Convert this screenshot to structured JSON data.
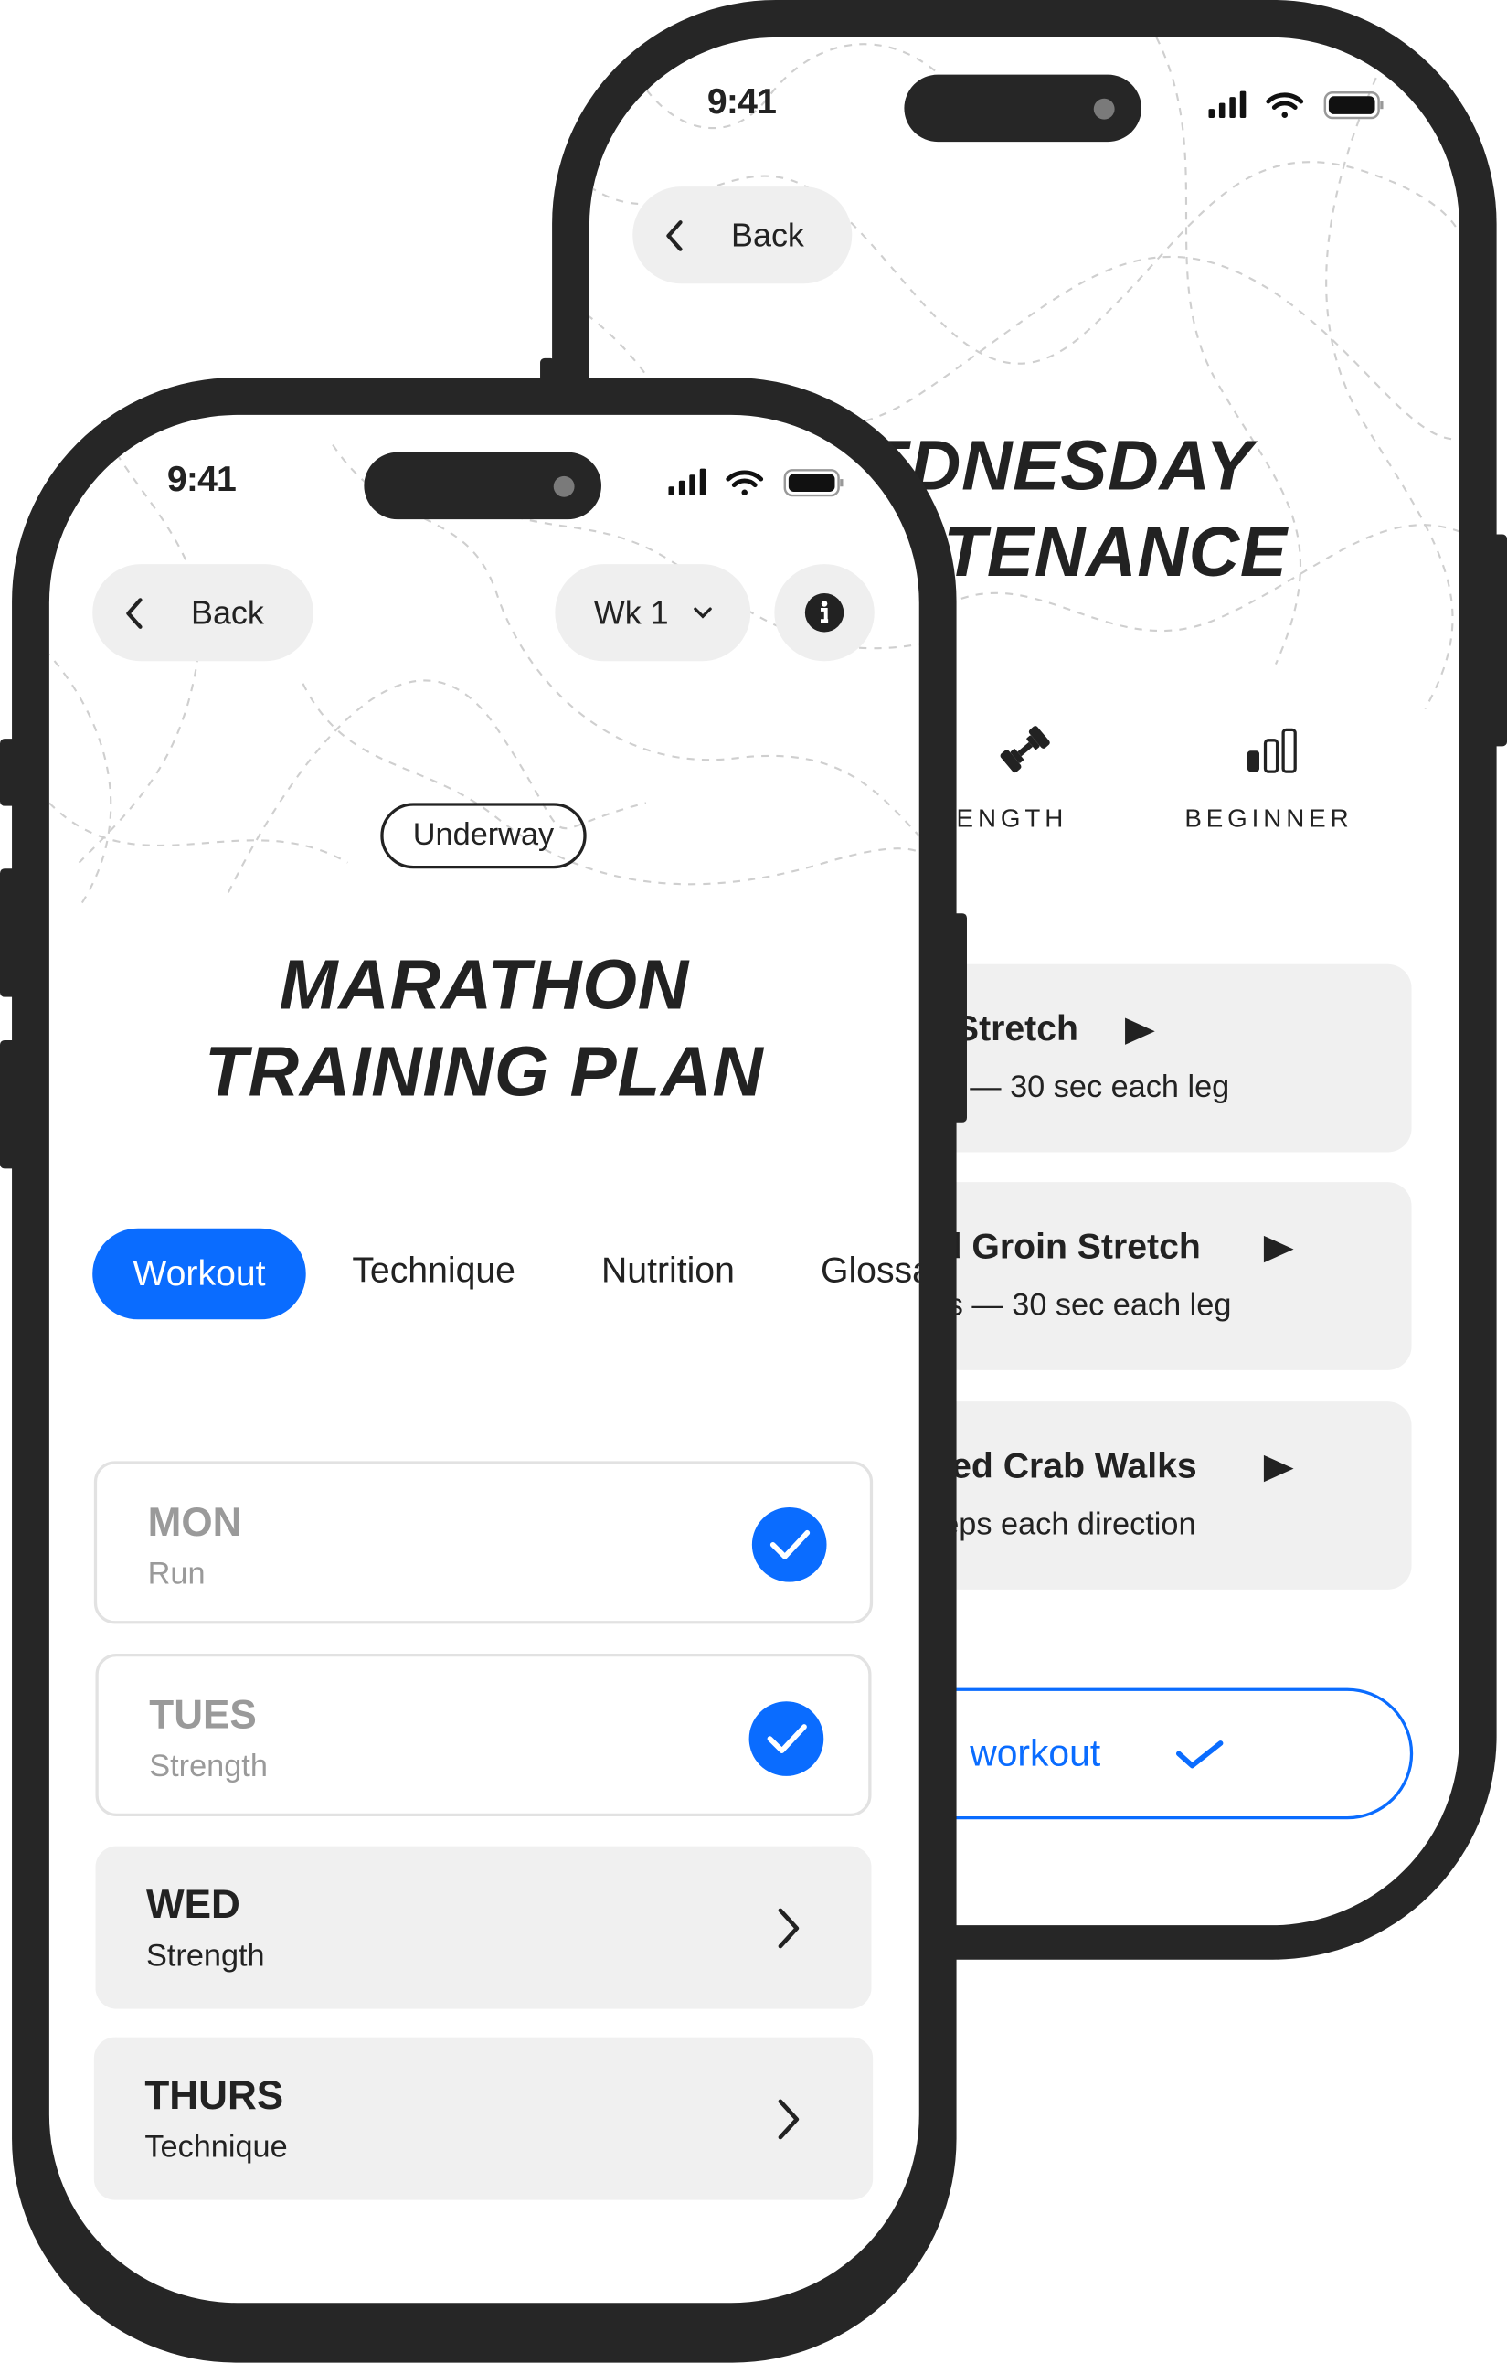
{
  "back_phone": {
    "status": {
      "time": "9:41"
    },
    "back_label": "Back",
    "title_line1": "WEDNESDAY",
    "title_line2": "MAINTENANCE",
    "tags": [
      {
        "icon": "dumbbell-icon",
        "label": "STRENGTH"
      },
      {
        "icon": "level-bars-icon",
        "label": "BEGINNER"
      }
    ],
    "exercises": [
      {
        "title": "Stretch",
        "detail": "— 30 sec each leg"
      },
      {
        "title": "d Groin Stretch",
        "detail": "s — 30 sec each leg"
      },
      {
        "title": "led Crab Walks",
        "detail": "eps each direction"
      }
    ],
    "complete_button_label": "workout"
  },
  "front_phone": {
    "status": {
      "time": "9:41"
    },
    "back_label": "Back",
    "week_selector": "Wk 1",
    "status_badge": "Underway",
    "title_line1": "MARATHON",
    "title_line2": "TRAINING PLAN",
    "tabs": [
      {
        "label": "Workout",
        "active": true
      },
      {
        "label": "Technique",
        "active": false
      },
      {
        "label": "Nutrition",
        "active": false
      },
      {
        "label": "Glossary",
        "active": false
      }
    ],
    "days": [
      {
        "day": "MON",
        "type": "Run",
        "completed": true
      },
      {
        "day": "TUES",
        "type": "Strength",
        "completed": true
      },
      {
        "day": "WED",
        "type": "Strength",
        "completed": false
      },
      {
        "day": "THURS",
        "type": "Technique",
        "completed": false
      }
    ]
  },
  "colors": {
    "accent": "#0a6cff",
    "frame": "#262626",
    "card": "#f0f0f0",
    "muted": "#9a9a9a"
  }
}
